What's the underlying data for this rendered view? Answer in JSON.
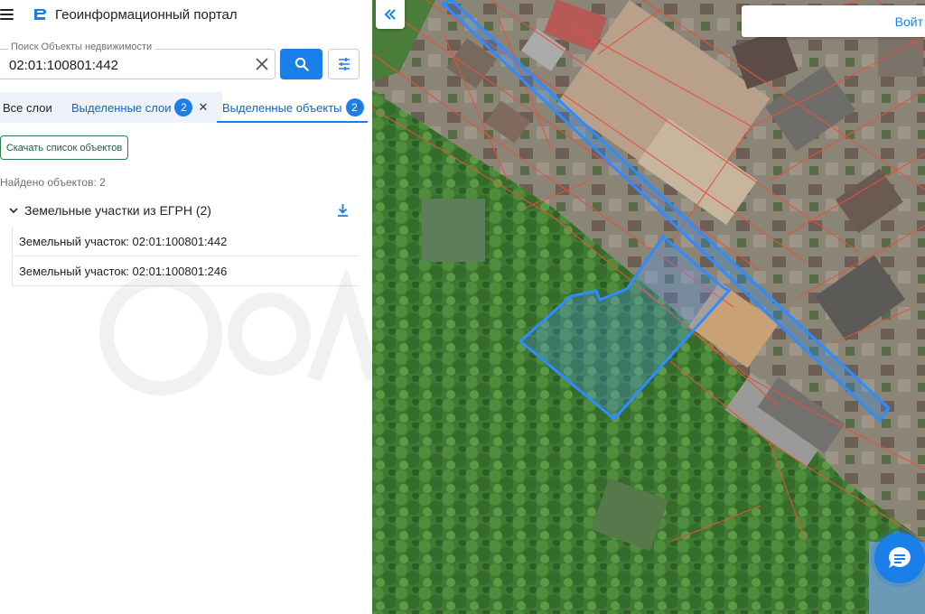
{
  "app": {
    "title": "Геоинформационный портал"
  },
  "search": {
    "label": "Поиск Объекты недвижимости",
    "value": "02:01:100801:442"
  },
  "tabs": {
    "all_layers": "Все слои",
    "selected_layers": "Выделенные слои",
    "selected_layers_count": "2",
    "selected_objects": "Выделенные объекты",
    "selected_objects_count": "2"
  },
  "actions": {
    "download_list": "Скачать список объектов"
  },
  "results": {
    "found_text": "Найдено объектов: 2",
    "group_title": "Земельные участки из ЕГРН (2)",
    "items": [
      {
        "label": "Земельный участок: 02:01:100801:442"
      },
      {
        "label": "Земельный участок: 02:01:100801:246"
      }
    ]
  },
  "map": {
    "login_label": "Войт",
    "parcel_line_color": "#e8503a",
    "selection_color": "#2f8cff"
  },
  "colors": {
    "accent": "#1a7fe8",
    "tab_background": "#eef3fb"
  },
  "icons": [
    "menu-icon",
    "portal-logo-icon",
    "close-icon",
    "search-icon",
    "filter-icon",
    "chevron-down-icon",
    "download-icon",
    "double-chevron-left-icon",
    "chat-icon"
  ]
}
